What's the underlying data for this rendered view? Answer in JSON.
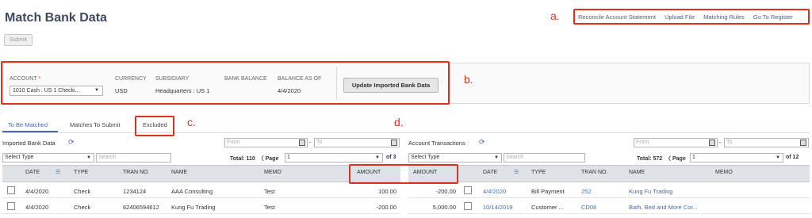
{
  "page": {
    "title": "Match Bank Data",
    "submit_label": "Submit"
  },
  "top_links": [
    "Reconcile Account Statement",
    "Upload File",
    "Matching Rules",
    "Go To Register"
  ],
  "annotations": {
    "a": "a.",
    "b": "b.",
    "c": "c.",
    "d": "d."
  },
  "account_panel": {
    "account_label": "ACCOUNT",
    "required_mark": "*",
    "account_value": "1010 Cash : US 1 Checki...",
    "currency_label": "CURRENCY",
    "currency_value": "USD",
    "subsidiary_label": "SUBSIDIARY",
    "subsidiary_value": "Headquarters : US 1",
    "bank_balance_label": "BANK BALANCE",
    "balance_as_of_label": "BALANCE AS OF",
    "balance_as_of_value": "4/4/2020",
    "update_button": "Update Imported Bank Data"
  },
  "tabs": {
    "to_be_matched": "To Be Matched",
    "matches_to_submit": "Matches To Submit",
    "excluded": "Excluded"
  },
  "imported": {
    "title": "Imported Bank Data",
    "type_select": "Select Type",
    "search_placeholder": "Search",
    "from_placeholder": "From",
    "to_placeholder": "To",
    "total_text": "Total: 110",
    "page_label": "Page",
    "page_value": "1",
    "of_text": "of 3",
    "columns": {
      "date": "DATE",
      "type": "TYPE",
      "tran_no": "TRAN NO.",
      "name": "NAME",
      "memo": "MEMO",
      "amount": "AMOUNT"
    },
    "rows": [
      {
        "date": "4/4/2020",
        "type": "Check",
        "tran_no": "1234124",
        "name": "AAA Consulting",
        "memo": "Test",
        "amount": "100.00"
      },
      {
        "date": "4/4/2020",
        "type": "Check",
        "tran_no": "62406594612",
        "name": "Kung Fu Trading",
        "memo": "Test",
        "amount": "-200.00"
      }
    ]
  },
  "account_tx": {
    "title": "Account Transactions",
    "type_select": "Select Type",
    "search_placeholder": "Search",
    "from_placeholder": "From",
    "to_placeholder": "To",
    "total_text": "Total: 572",
    "page_label": "Page",
    "page_value": "1",
    "of_text": "of 12",
    "columns": {
      "amount": "AMOUNT",
      "date": "DATE",
      "type": "TYPE",
      "tran_no": "TRAN NO.",
      "name": "NAME",
      "memo": "MEMO"
    },
    "rows": [
      {
        "amount": "-200.00",
        "date": "4/4/2020",
        "type": "Bill Payment",
        "tran_no": "252",
        "name": "Kung Fu Trading",
        "memo": ""
      },
      {
        "amount": "5,000.00",
        "date": "10/14/2019",
        "type": "Customer ...",
        "tran_no": "CD08",
        "name": "Bath, Bed and More Cor...",
        "memo": ""
      }
    ]
  }
}
